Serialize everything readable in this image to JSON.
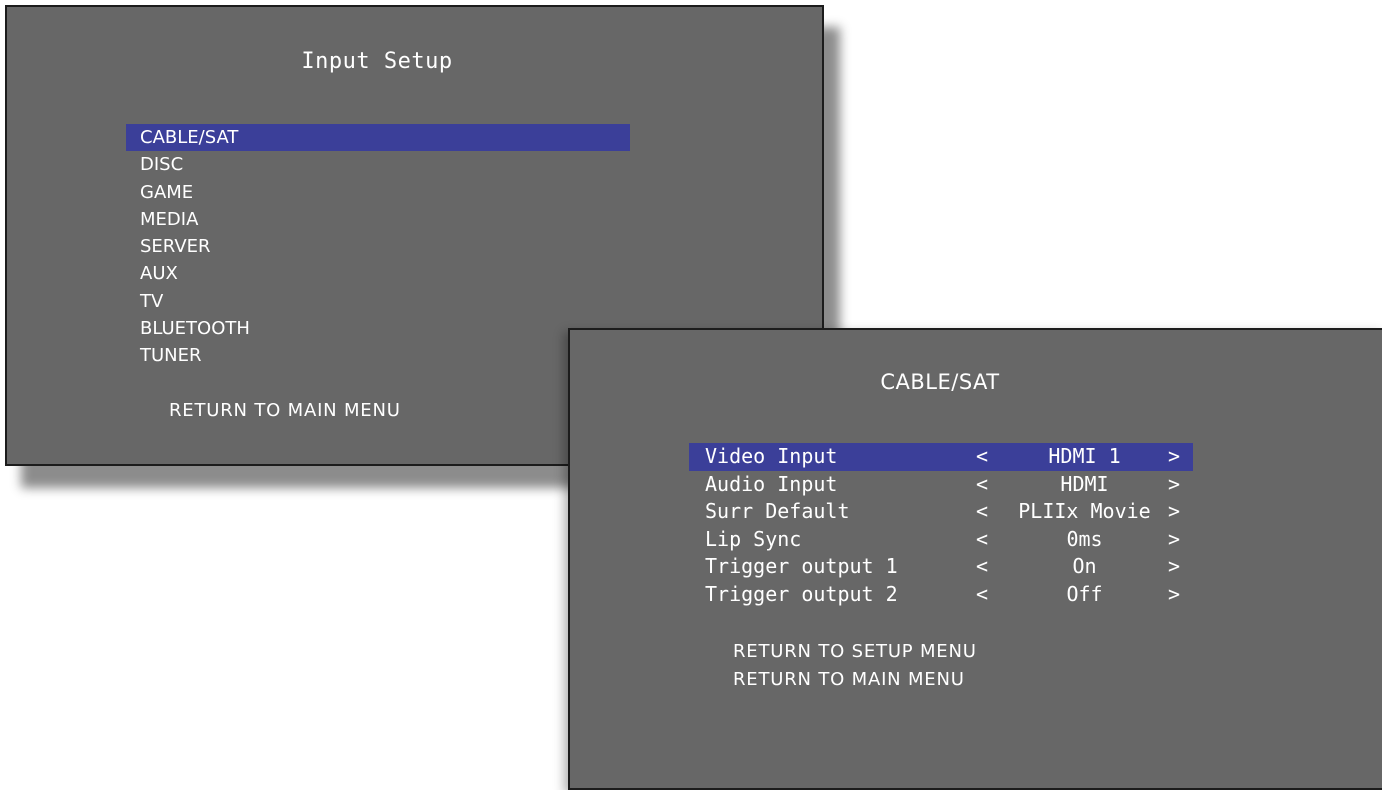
{
  "input_setup": {
    "title": "Input Setup",
    "items": [
      {
        "label": "CABLE/SAT",
        "selected": true
      },
      {
        "label": "DISC",
        "selected": false
      },
      {
        "label": "GAME",
        "selected": false
      },
      {
        "label": "MEDIA",
        "selected": false
      },
      {
        "label": "SERVER",
        "selected": false
      },
      {
        "label": "AUX",
        "selected": false
      },
      {
        "label": "TV",
        "selected": false
      },
      {
        "label": "BLUETOOTH",
        "selected": false
      },
      {
        "label": "TUNER",
        "selected": false
      }
    ],
    "return_label": "RETURN TO MAIN MENU"
  },
  "cable_sat": {
    "title": "CABLE/SAT",
    "rows": [
      {
        "label": "Video Input",
        "left": "<",
        "value": "HDMI 1",
        "right": ">",
        "selected": true
      },
      {
        "label": "Audio Input",
        "left": "<",
        "value": "HDMI",
        "right": ">",
        "selected": false
      },
      {
        "label": "Surr Default",
        "left": "<",
        "value": "PLIIx Movie",
        "right": ">",
        "selected": false
      },
      {
        "label": "Lip Sync",
        "left": "<",
        "value": "0ms",
        "right": ">",
        "selected": false
      },
      {
        "label": "Trigger output 1",
        "left": "<",
        "value": "On",
        "right": ">",
        "selected": false
      },
      {
        "label": "Trigger output 2",
        "left": "<",
        "value": "Off",
        "right": ">",
        "selected": false
      }
    ],
    "return_setup_label": "RETURN TO SETUP MENU",
    "return_main_label": "RETURN TO MAIN MENU"
  },
  "colors": {
    "panel_background": "#676767",
    "highlight": "#3b3f99",
    "text": "#ffffff"
  }
}
